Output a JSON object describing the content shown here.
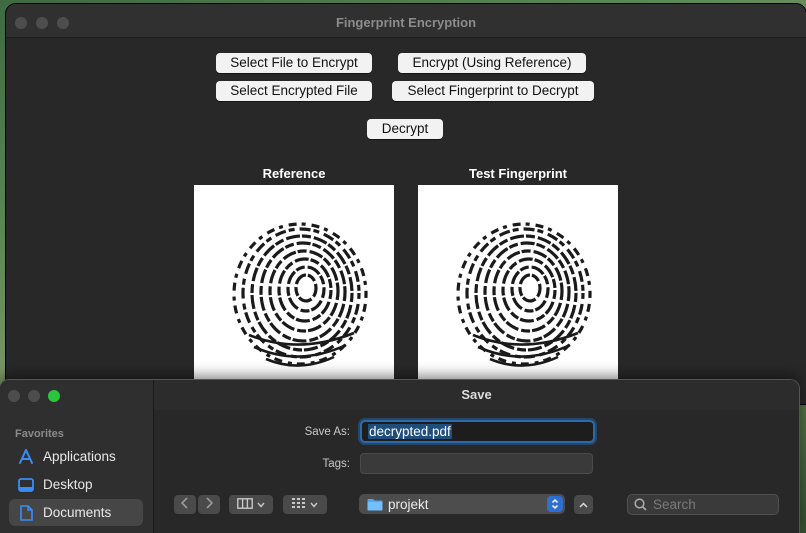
{
  "app": {
    "title": "Fingerprint Encryption",
    "buttons": {
      "select_file": "Select File to Encrypt",
      "encrypt_ref": "Encrypt (Using Reference)",
      "select_encrypted": "Select Encrypted File",
      "select_fingerprint": "Select Fingerprint to Decrypt",
      "decrypt": "Decrypt"
    },
    "images": {
      "reference_label": "Reference",
      "test_label": "Test Fingerprint"
    }
  },
  "save_dialog": {
    "title": "Save",
    "save_as_label": "Save As:",
    "save_as_value": "decrypted.pdf",
    "tags_label": "Tags:",
    "tags_value": "",
    "location": "projekt",
    "search_placeholder": "Search",
    "sidebar": {
      "heading": "Favorites",
      "items": [
        {
          "label": "Applications",
          "icon": "applications-icon"
        },
        {
          "label": "Desktop",
          "icon": "desktop-icon"
        },
        {
          "label": "Documents",
          "icon": "documents-icon",
          "selected": true
        }
      ]
    }
  },
  "colors": {
    "accent": "#2f6fd0",
    "focus_ring": "#2a6bb0",
    "traffic_green": "#2ac53f",
    "window_bg": "#282828"
  }
}
